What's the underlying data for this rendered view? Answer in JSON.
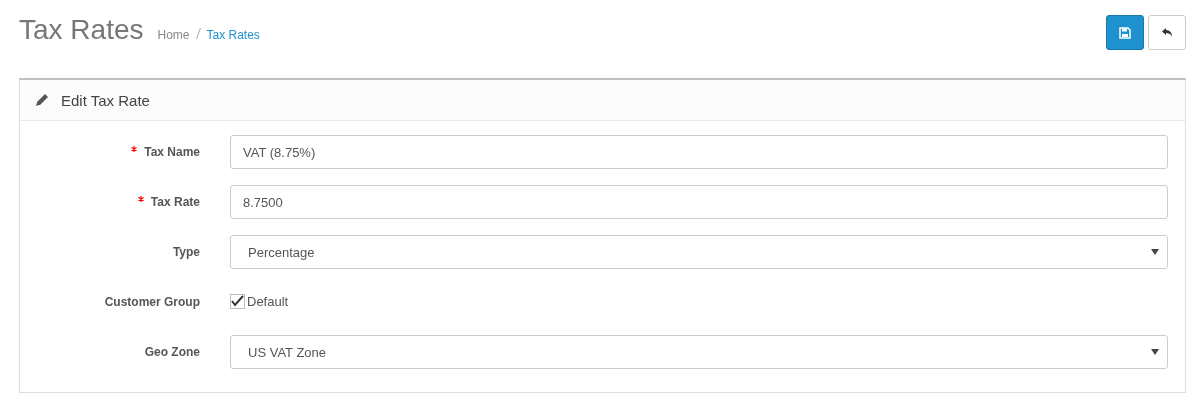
{
  "header": {
    "title": "Tax Rates",
    "breadcrumb": [
      {
        "label": "Home",
        "current": false
      },
      {
        "label": "Tax Rates",
        "current": true
      }
    ]
  },
  "panel": {
    "title": "Edit Tax Rate"
  },
  "fields": [
    {
      "kind": "text",
      "label": "Tax Name",
      "required": true,
      "value": "VAT (8.75%)"
    },
    {
      "kind": "text",
      "label": "Tax Rate",
      "required": true,
      "value": "8.7500"
    },
    {
      "kind": "select",
      "label": "Type",
      "required": false,
      "value": "Percentage"
    },
    {
      "kind": "checkbox",
      "label": "Customer Group",
      "required": false,
      "option": "Default",
      "checked": true
    },
    {
      "kind": "select",
      "label": "Geo Zone",
      "required": false,
      "value": "US VAT Zone"
    }
  ]
}
